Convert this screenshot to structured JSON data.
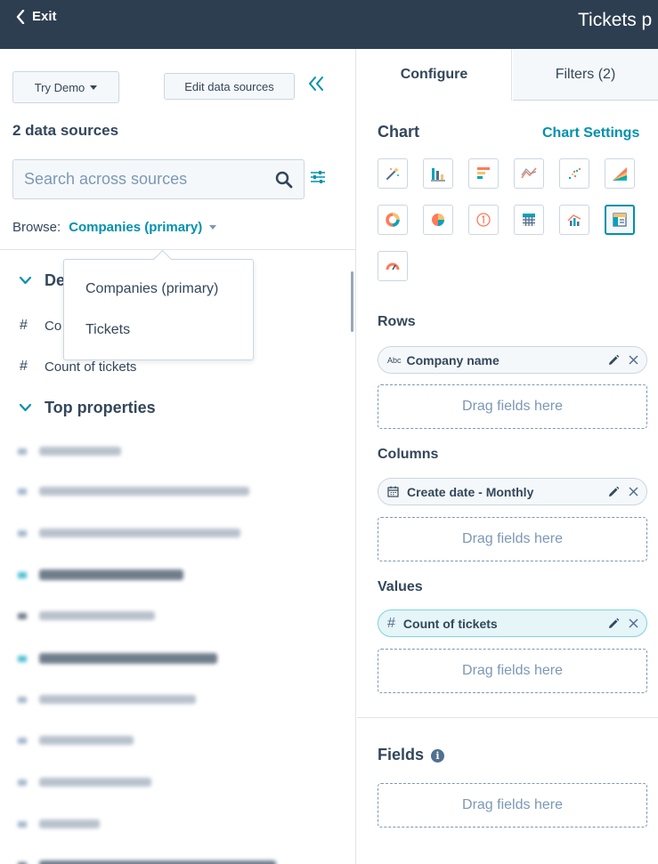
{
  "header": {
    "exit_label": "Exit",
    "title": "Tickets p"
  },
  "left": {
    "try_demo_label": "Try Demo",
    "edit_sources_label": "Edit data sources",
    "data_sources_count": "2 data sources",
    "search_placeholder": "Search across sources",
    "browse_label": "Browse:",
    "browse_value": "Companies (primary)",
    "dropdown_options": [
      "Companies (primary)",
      "Tickets"
    ],
    "default_group_partial": "De",
    "first_property_partial": "Co",
    "count_of_tickets": "Count of tickets",
    "top_properties": "Top properties"
  },
  "right": {
    "tabs": {
      "configure": "Configure",
      "filters": "Filters (2)"
    },
    "chart_heading": "Chart",
    "chart_settings": "Chart Settings",
    "rows_heading": "Rows",
    "rows_field": "Company name",
    "rows_field_type": "Abc",
    "columns_heading": "Columns",
    "columns_field": "Create date - Monthly",
    "values_heading": "Values",
    "values_field": "Count of tickets",
    "values_field_type": "#",
    "drop_placeholder": "Drag fields here",
    "fields_heading": "Fields",
    "fields_info": "i"
  },
  "colors": {
    "accent": "#0091ae",
    "header_bg": "#2d3e50",
    "text": "#33475b"
  }
}
